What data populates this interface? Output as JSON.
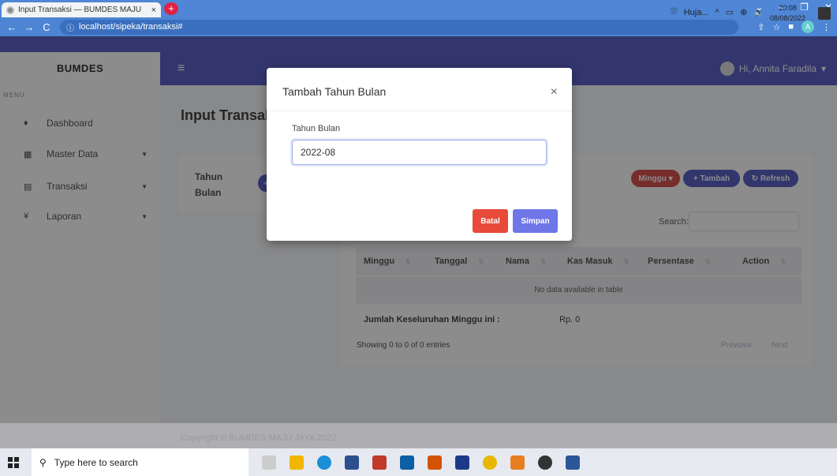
{
  "browser": {
    "tab_title": "Input Transaksi — BUMDES MAJU",
    "tab_close": "×",
    "new_tab": "+",
    "url": "localhost/sipeka/transaksi#",
    "window_controls": [
      "⌄",
      "–",
      "❐",
      "✕"
    ]
  },
  "sidebar": {
    "brand": "BUMDES",
    "menu_label": "MENU",
    "items": [
      {
        "label": "Dashboard",
        "icon": "palette-icon"
      },
      {
        "label": "Master Data",
        "icon": "grid-icon"
      },
      {
        "label": "Transaksi",
        "icon": "file-icon"
      },
      {
        "label": "Laporan",
        "icon": "cash-icon"
      }
    ]
  },
  "header": {
    "user_greeting": "Hi, Annita Faradila"
  },
  "page": {
    "title": "Input Transaksi",
    "left_card_label": "Tahun Bulan",
    "buttons": {
      "minggu": "Minggu",
      "tambah": "+ Tambah",
      "refresh": "Refresh"
    },
    "search_label": "Search:",
    "table": {
      "columns": [
        "Minggu",
        "Tanggal",
        "Nama",
        "Kas Masuk",
        "Persentase",
        "Action"
      ],
      "empty_text": "No data available in table",
      "summary_label": "Jumlah Keseluruhan Minggu ini :",
      "summary_value": "Rp. 0"
    },
    "showing": "Showing 0 to 0 of 0 entries",
    "pager": {
      "previous": "Previous",
      "next": "Next"
    },
    "footer": "Copyright © BUMDES MAJU JAYA 2022"
  },
  "modal": {
    "title": "Tambah Tahun Bulan",
    "close": "×",
    "field_label": "Tahun Bulan",
    "field_value": "2022-08",
    "cancel": "Batal",
    "save": "Simpan"
  },
  "taskbar": {
    "search_placeholder": "Type here to search",
    "tray_text": "Huja...",
    "time": "20:08",
    "date": "08/08/2022"
  },
  "colors": {
    "primary": "#5b63c7",
    "danger": "#e74a3b",
    "minggu": "#d9534f"
  }
}
